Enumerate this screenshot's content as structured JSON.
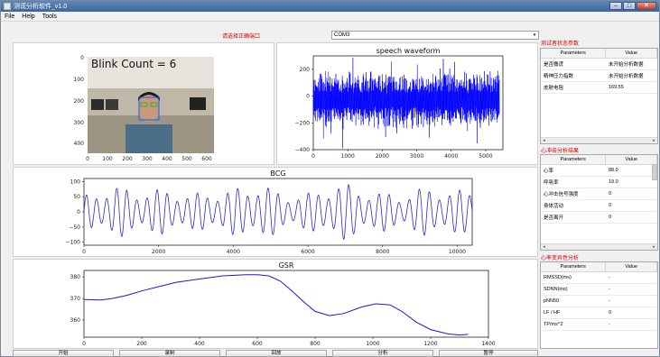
{
  "window": {
    "title": "测谎分析软件_v1.0",
    "min": "–",
    "max": "□",
    "close": "✕"
  },
  "menu": [
    "File",
    "Help",
    "Tools"
  ],
  "toolbar": {
    "label": "请选择正确端口",
    "combo_value": "COM3",
    "combo_arrow": "▾"
  },
  "video": {
    "overlay": "Blink Count = 6"
  },
  "speech": {
    "chart_data": {
      "type": "line",
      "title": "speech waveform",
      "xlabel": "",
      "ylabel": "",
      "xlim": [
        0,
        5500
      ],
      "ylim": [
        -400,
        300
      ],
      "xticks": [
        "0",
        "1000",
        "2000",
        "3000",
        "4000",
        "5000"
      ],
      "yticks": [
        "200",
        "0",
        "−200",
        "−400"
      ],
      "color": "#0000ff"
    }
  },
  "bcg": {
    "chart_data": {
      "type": "line",
      "title": "BCG",
      "xlabel": "",
      "ylabel": "",
      "xlim": [
        0,
        10400
      ],
      "ylim": [
        -110,
        110
      ],
      "xticks": [
        "0",
        "2000",
        "4000",
        "6000",
        "8000",
        "10000"
      ],
      "yticks": [
        "100",
        "50",
        "0",
        "−50",
        "−100"
      ],
      "color": "#2a2acc"
    }
  },
  "gsr": {
    "chart_data": {
      "type": "line",
      "title": "GSR",
      "xlabel": "",
      "ylabel": "",
      "xlim": [
        0,
        1400
      ],
      "ylim": [
        352,
        383
      ],
      "xticks": [
        "0",
        "200",
        "400",
        "600",
        "800",
        "1000",
        "1200",
        "1400"
      ],
      "yticks": [
        "380",
        "370",
        "360"
      ],
      "color": "#1a1acc",
      "x": [
        0,
        60,
        100,
        150,
        200,
        260,
        320,
        400,
        480,
        560,
        600,
        640,
        680,
        720,
        760,
        800,
        850,
        900,
        960,
        1010,
        1060,
        1100,
        1150,
        1200,
        1260,
        1300,
        1330
      ],
      "y": [
        369.5,
        369.3,
        370.0,
        371.5,
        373.5,
        375.5,
        377.5,
        379.0,
        380.5,
        381.0,
        381.0,
        380.5,
        378.0,
        373.5,
        368.5,
        364.0,
        362.0,
        363.0,
        366.0,
        367.5,
        367.0,
        364.0,
        359.0,
        355.5,
        353.5,
        353.0,
        353.3
      ]
    }
  },
  "panel_stress": {
    "title": "测试者状态参数",
    "headers": [
      "Parameters",
      "Value"
    ],
    "rows": [
      [
        "是否撒谎",
        "未开始分析数据"
      ],
      [
        "精神压力指数",
        "未开始分析数据"
      ],
      [
        "皮肤电阻",
        "169.55"
      ]
    ]
  },
  "panel_heart": {
    "title": "心冲击分析结果",
    "headers": [
      "Parameters",
      "Value"
    ],
    "rows": [
      [
        "心率",
        "88.0"
      ],
      [
        "呼吸率",
        "19.0"
      ],
      [
        "心冲击信号强度",
        "0"
      ],
      [
        "身体活动",
        "0"
      ],
      [
        "是否离开",
        "0"
      ]
    ]
  },
  "panel_hrv": {
    "title": "心率变异性分析",
    "headers": [
      "Parameters",
      "Value"
    ],
    "rows": [
      [
        "RMSSD(ms)",
        "-"
      ],
      [
        "SDNN(ms)",
        "-"
      ],
      [
        "pNN50",
        "-"
      ],
      [
        "LF / HF",
        "0"
      ],
      [
        "TP/ms^2",
        "-"
      ]
    ]
  },
  "buttons": [
    "开始",
    "录制",
    "回放",
    "分析",
    "暂停"
  ]
}
